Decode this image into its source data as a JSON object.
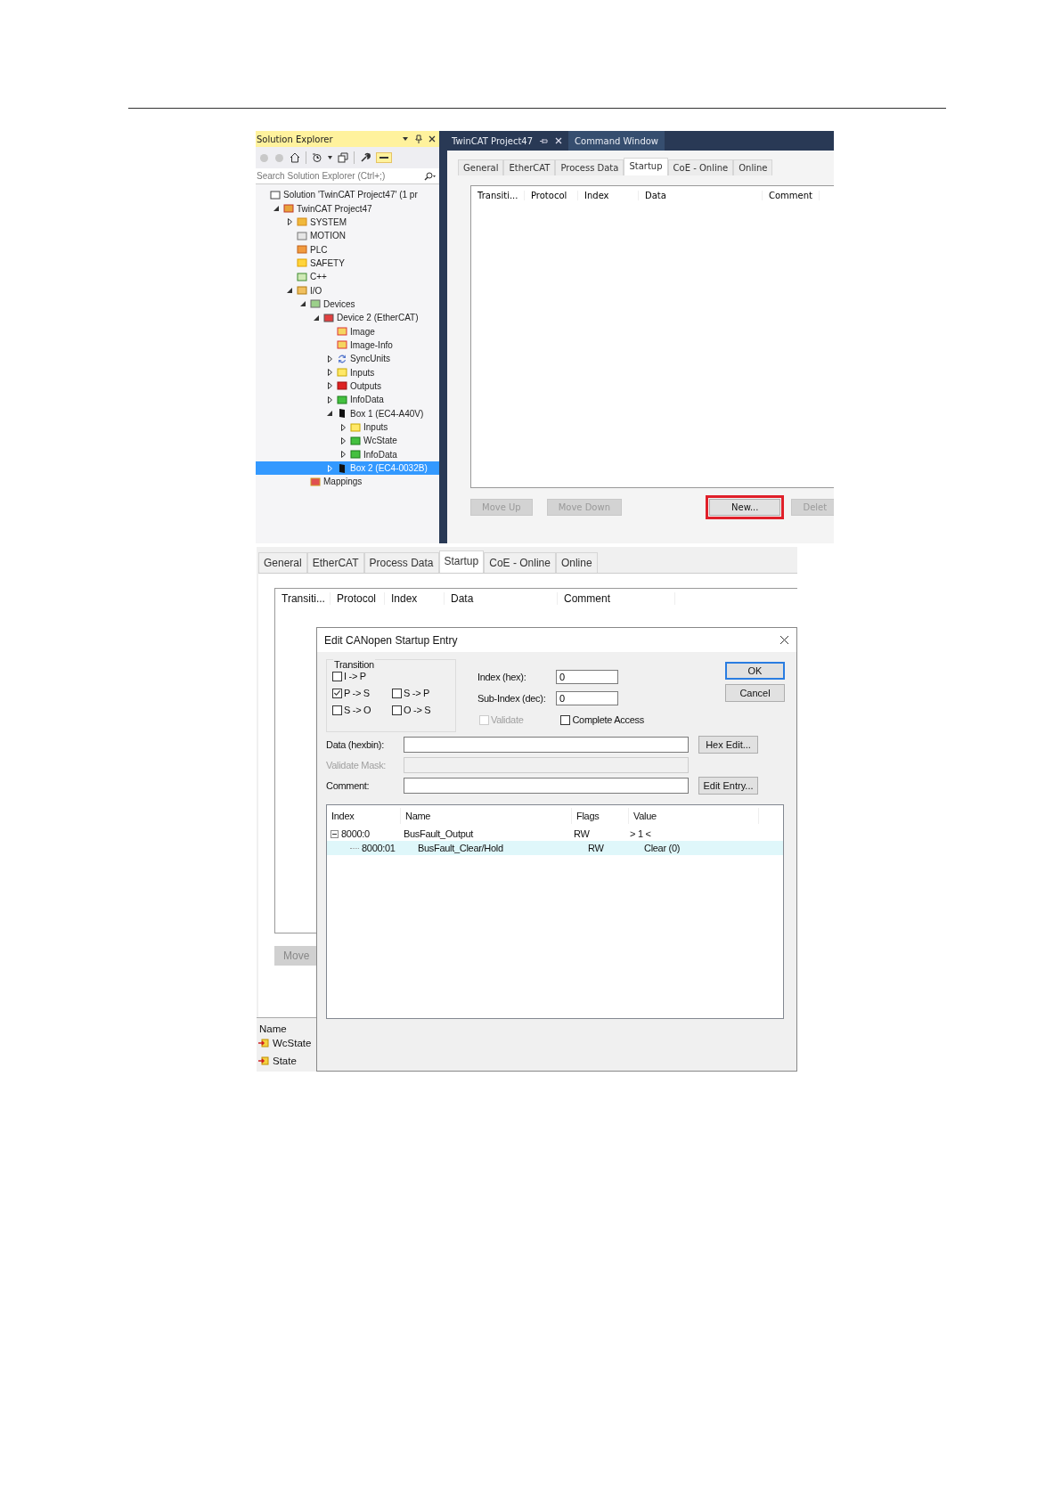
{
  "solution_explorer": {
    "title": "Solution Explorer",
    "preview_on": true,
    "search": {
      "placeholder": "Search Solution Explorer (Ctrl+;)"
    },
    "tree": [
      {
        "label": "Solution 'TwinCAT Project47' (1 pr",
        "kind": "solution",
        "selected": false,
        "children": [
          {
            "label": "TwinCAT Project47",
            "kind": "project",
            "expanded": true,
            "selected": false,
            "children": [
              {
                "label": "SYSTEM",
                "kind": "system",
                "expanded": false,
                "selected": false
              },
              {
                "label": "MOTION",
                "kind": "motion",
                "selected": false
              },
              {
                "label": "PLC",
                "kind": "plc",
                "selected": false
              },
              {
                "label": "SAFETY",
                "kind": "safety",
                "selected": false
              },
              {
                "label": "C++",
                "kind": "cpp",
                "selected": false
              },
              {
                "label": "I/O",
                "kind": "io",
                "expanded": true,
                "selected": false,
                "children": [
                  {
                    "label": "Devices",
                    "kind": "devices",
                    "expanded": true,
                    "selected": false,
                    "children": [
                      {
                        "label": "Device 2 (EtherCAT)",
                        "kind": "device",
                        "expanded": true,
                        "selected": false,
                        "children": [
                          {
                            "label": "Image",
                            "kind": "image",
                            "selected": false
                          },
                          {
                            "label": "Image-Info",
                            "kind": "image",
                            "selected": false
                          },
                          {
                            "label": "SyncUnits",
                            "kind": "sync",
                            "expanded": false,
                            "selected": false
                          },
                          {
                            "label": "Inputs",
                            "kind": "inputs",
                            "expanded": false,
                            "selected": false
                          },
                          {
                            "label": "Outputs",
                            "kind": "outputs",
                            "expanded": false,
                            "selected": false
                          },
                          {
                            "label": "InfoData",
                            "kind": "infodata",
                            "expanded": false,
                            "selected": false
                          },
                          {
                            "label": "Box 1 (EC4-A40V)",
                            "kind": "box",
                            "expanded": true,
                            "selected": false,
                            "children": [
                              {
                                "label": "Inputs",
                                "kind": "inputs",
                                "expanded": false,
                                "selected": false
                              },
                              {
                                "label": "WcState",
                                "kind": "infodata",
                                "expanded": false,
                                "selected": false
                              },
                              {
                                "label": "InfoData",
                                "kind": "infodata",
                                "expanded": false,
                                "selected": false
                              }
                            ]
                          },
                          {
                            "label": "Box 2 (EC4-0032B)",
                            "kind": "box",
                            "expanded": false,
                            "selected": true
                          }
                        ]
                      }
                    ]
                  },
                  {
                    "label": "Mappings",
                    "kind": "mappings",
                    "selected": false
                  }
                ]
              }
            ]
          }
        ]
      }
    ]
  },
  "editor": {
    "documents": [
      {
        "label": "TwinCAT Project47",
        "selected": true
      },
      {
        "label": "Command Window",
        "selected": false
      }
    ],
    "tabs": [
      {
        "label": "General",
        "selected": false
      },
      {
        "label": "EtherCAT",
        "selected": false
      },
      {
        "label": "Process Data",
        "selected": false
      },
      {
        "label": "Startup",
        "selected": true
      },
      {
        "label": "CoE - Online",
        "selected": false
      },
      {
        "label": "Online",
        "selected": false
      }
    ],
    "columns": [
      "Transiti...",
      "Protocol",
      "Index",
      "Data",
      "Comment"
    ],
    "buttons": [
      {
        "label": "Move Up",
        "disabled": true,
        "highlighted": false
      },
      {
        "label": "Move Down",
        "disabled": true,
        "highlighted": false
      },
      {
        "label": "New...",
        "disabled": false,
        "highlighted": true
      },
      {
        "label": "Delet",
        "disabled": true,
        "highlighted": false
      }
    ]
  },
  "second_view": {
    "tabs": [
      {
        "label": "General",
        "selected": false
      },
      {
        "label": "EtherCAT",
        "selected": false
      },
      {
        "label": "Process Data",
        "selected": false
      },
      {
        "label": "Startup",
        "selected": true
      },
      {
        "label": "CoE - Online",
        "selected": false
      },
      {
        "label": "Online",
        "selected": false
      }
    ],
    "columns": [
      "Transiti...",
      "Protocol",
      "Index",
      "Data",
      "Comment"
    ],
    "move_button": "Move",
    "name_header": "Name",
    "variables": [
      "WcState",
      "State"
    ],
    "dialog": {
      "title": "Edit CANopen Startup Entry",
      "transition_title": "Transition",
      "transitions": [
        {
          "label": "I -> P",
          "checked": false
        },
        {
          "label": "P -> S",
          "checked": true
        },
        {
          "label": "S -> P",
          "checked": false
        },
        {
          "label": "S -> O",
          "checked": false
        },
        {
          "label": "O -> S",
          "checked": false
        }
      ],
      "index_label": "Index (hex):",
      "index_value": "0",
      "subindex_label": "Sub-Index (dec):",
      "subindex_value": "0",
      "validate": {
        "label": "Validate",
        "checked": false,
        "disabled": true
      },
      "complete_access": {
        "label": "Complete Access",
        "checked": false,
        "disabled": false
      },
      "ok": "OK",
      "cancel": "Cancel",
      "data_label": "Data (hexbin):",
      "mask_label": "Validate Mask:",
      "comment_label": "Comment:",
      "hex_edit": "Hex Edit...",
      "edit_entry": "Edit Entry...",
      "list_columns": [
        "Index",
        "Name",
        "Flags",
        "Value"
      ],
      "rows": [
        {
          "index": "8000:0",
          "name": "BusFault_Output",
          "flags": "RW",
          "value": "> 1 <",
          "selected": false,
          "expanded": true,
          "children": [
            {
              "index": "8000:01",
              "name": "BusFault_Clear/Hold",
              "flags": "RW",
              "value": "Clear (0)",
              "selected": true
            }
          ]
        }
      ]
    }
  }
}
